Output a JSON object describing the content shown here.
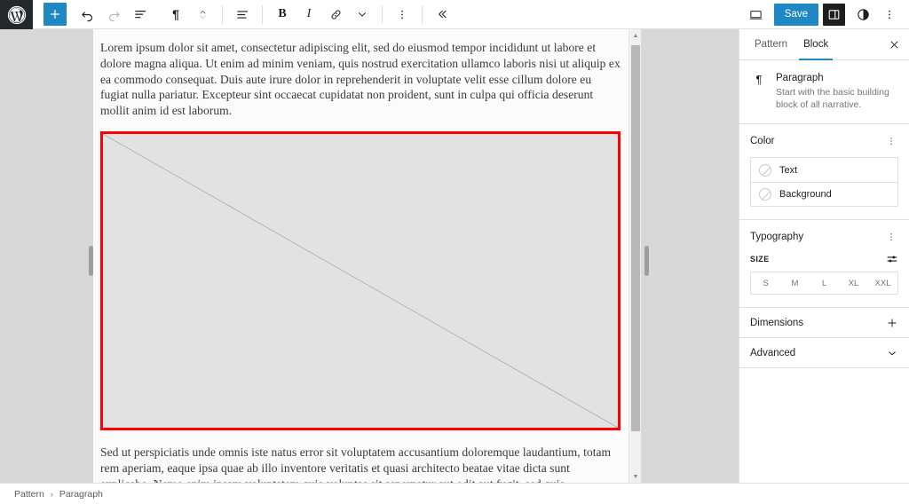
{
  "app": {
    "name": "WordPress Block Editor",
    "logo_icon": "wordpress-logo-icon"
  },
  "toolbar": {
    "add_block_label": "+",
    "add_block_icon": "plus-icon",
    "undo_icon": "undo-arrow-icon",
    "redo_icon": "redo-arrow-icon",
    "list_view_icon": "list-view-icon",
    "block_type_icon": "paragraph-pilcrow-icon",
    "block_type_glyph": "¶",
    "move_updown_icon": "move-up-down-icon",
    "align_icon": "text-align-icon",
    "bold_label": "B",
    "bold_icon": "bold-icon",
    "italic_label": "I",
    "italic_icon": "italic-icon",
    "link_icon": "link-icon",
    "more_rich_text_icon": "chevron-down-icon",
    "block_options_icon": "vertical-ellipsis-icon",
    "collapse_icon": "double-chevron-left-icon",
    "preview_icon": "desktop-preview-icon",
    "save_label": "Save",
    "settings_sidebar_icon": "sidebar-panel-icon",
    "styles_icon": "contrast-circle-icon",
    "options_icon": "vertical-ellipsis-icon"
  },
  "editor": {
    "blocks": [
      {
        "type": "paragraph",
        "text": "Lorem ipsum dolor sit amet, consectetur adipiscing elit, sed do eiusmod tempor incididunt ut labore et dolore magna aliqua. Ut enim ad minim veniam, quis nostrud exercitation ullamco laboris nisi ut aliquip ex ea commodo consequat. Duis aute irure dolor in reprehenderit in voluptate velit esse cillum dolore eu fugiat nulla pariatur. Excepteur sint occaecat cupidatat non proident, sunt in culpa qui officia deserunt mollit anim id est laborum."
      },
      {
        "type": "image-placeholder",
        "selected": true,
        "selection_color": "#ff0000",
        "alt": ""
      },
      {
        "type": "paragraph",
        "text": "Sed ut perspiciatis unde omnis iste natus error sit voluptatem accusantium doloremque laudantium, totam rem aperiam, eaque ipsa quae ab illo inventore veritatis et quasi architecto beatae vitae dicta sunt explicabo. Nemo enim ipsam voluptatem quia voluptas sit aspernatur aut odit aut fugit, sed quia consequuntur magni dolores eos qui ratione voluptatem sequi nesciunt."
      }
    ],
    "scrollbar": {
      "up_arrow_glyph": "▲",
      "down_arrow_glyph": "▼",
      "name": "editor-vertical-scrollbar"
    },
    "left_resize_handle": "left-canvas-resize-handle",
    "right_resize_handle": "right-canvas-resize-handle"
  },
  "sidebar": {
    "tabs": [
      {
        "label": "Pattern",
        "active": false
      },
      {
        "label": "Block",
        "active": true
      }
    ],
    "close_icon": "close-x-icon",
    "active_tab_color": "#1e87c4",
    "block_card": {
      "icon": "paragraph-pilcrow-icon",
      "icon_glyph": "¶",
      "title": "Paragraph",
      "description": "Start with the basic building block of all narrative."
    },
    "color_panel": {
      "title": "Color",
      "more_icon": "vertical-ellipsis-icon",
      "rows": [
        {
          "label": "Text",
          "swatch": "empty-color-swatch"
        },
        {
          "label": "Background",
          "swatch": "empty-color-swatch"
        }
      ]
    },
    "typography_panel": {
      "title": "Typography",
      "more_icon": "vertical-ellipsis-icon",
      "size_label": "SIZE",
      "size_tools_icon": "sliders-settings-icon",
      "size_options": [
        "S",
        "M",
        "L",
        "XL",
        "XXL"
      ],
      "selected_size": null
    },
    "dimensions_panel": {
      "title": "Dimensions",
      "icon": "plus-icon"
    },
    "advanced_panel": {
      "title": "Advanced",
      "icon": "chevron-down-icon"
    }
  },
  "statusbar": {
    "breadcrumb": [
      "Pattern",
      "Paragraph"
    ],
    "separator": "›"
  }
}
